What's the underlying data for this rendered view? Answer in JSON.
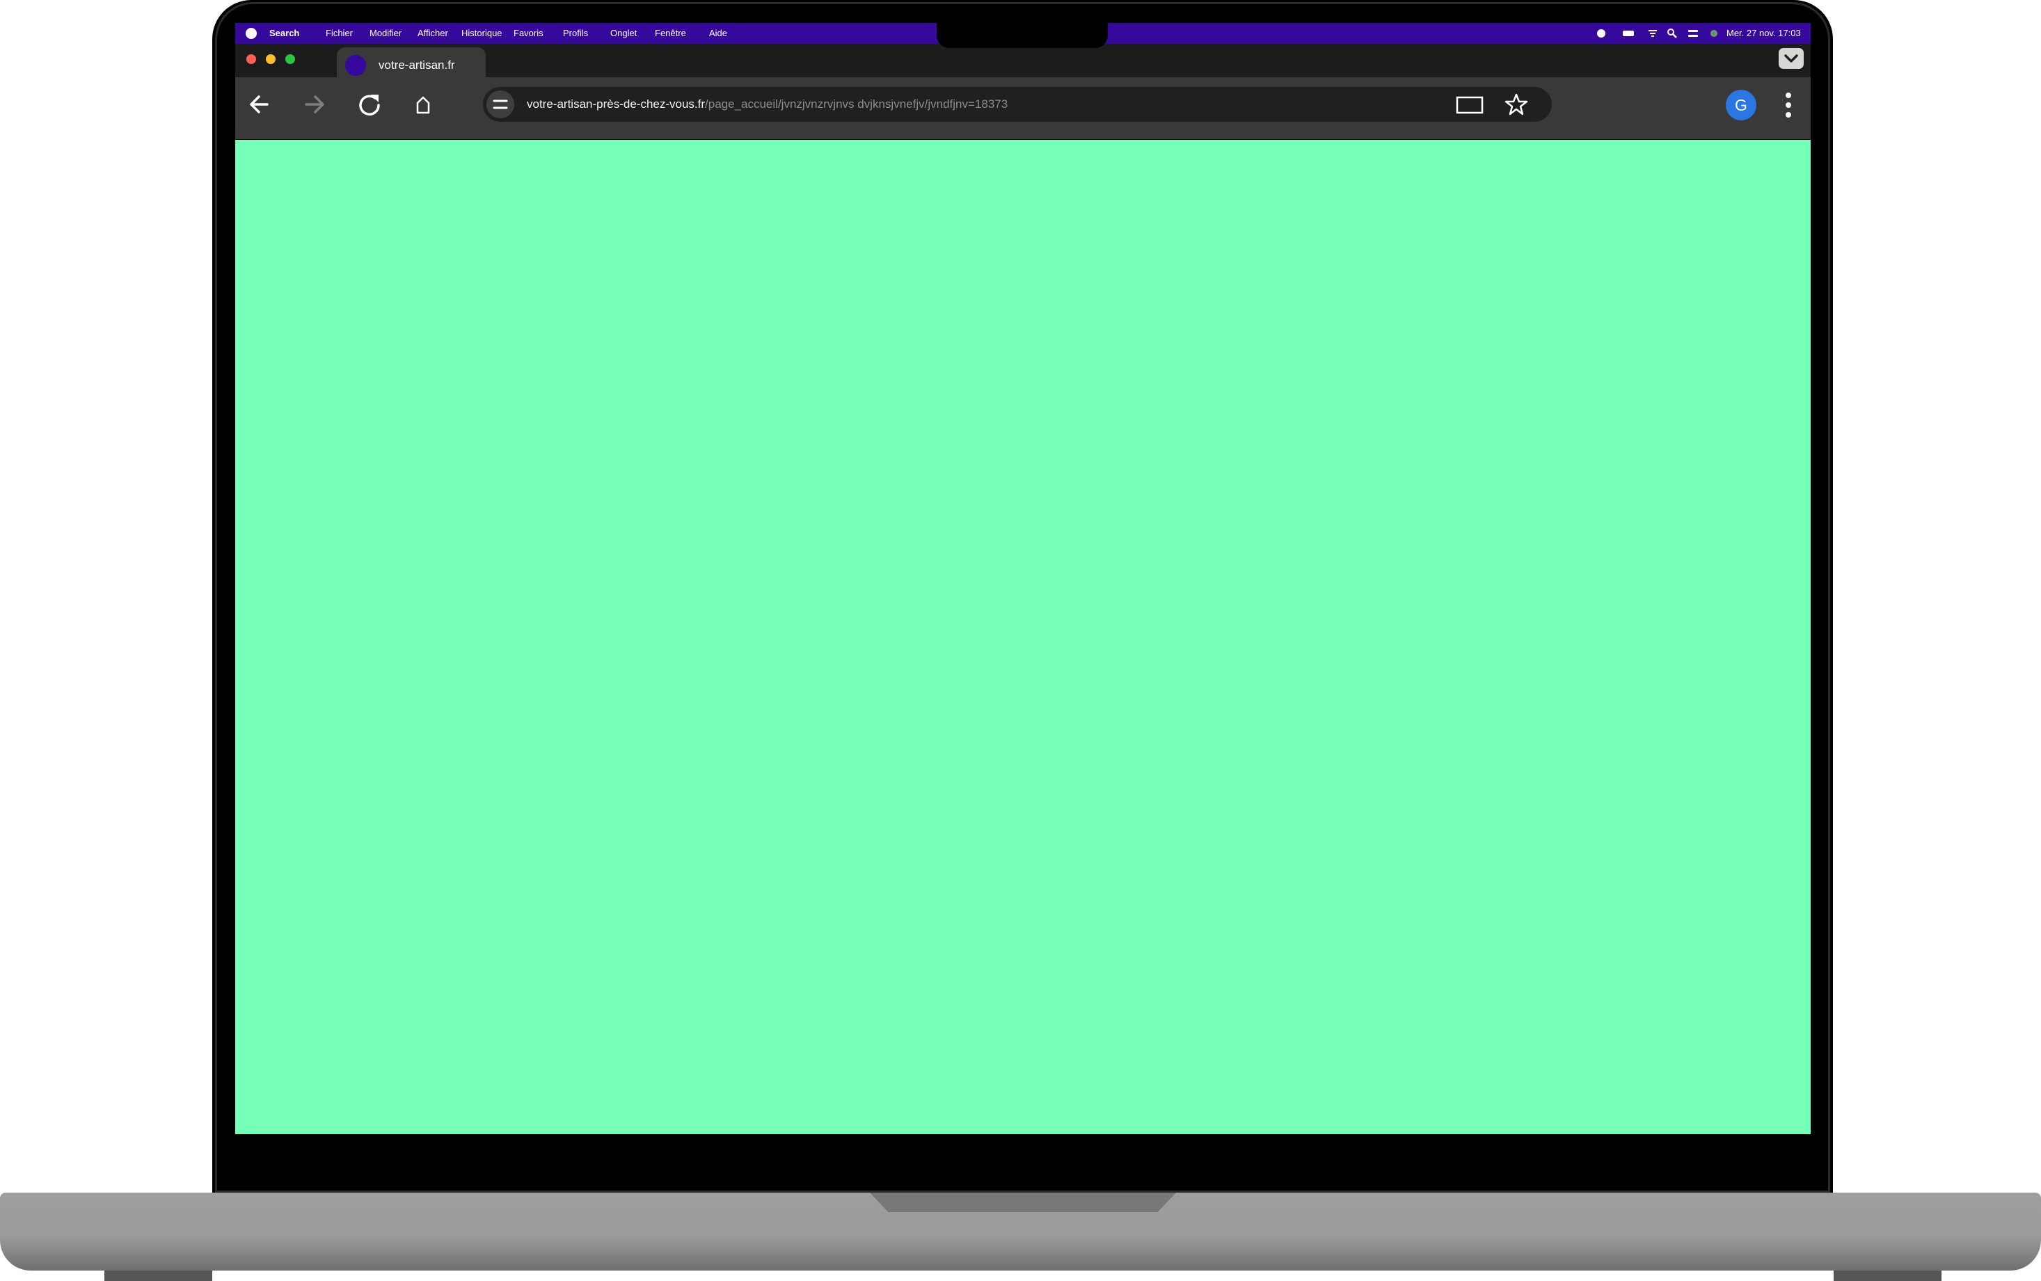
{
  "menubar": {
    "app_name": "Search",
    "items": [
      "Fichier",
      "Modifier",
      "Afficher",
      "Historique",
      "Favoris",
      "Profils",
      "Onglet",
      "Fenêtre",
      "Aide"
    ],
    "clock": "Mer. 27 nov. 17:03",
    "status_icons": [
      "record-dot-icon",
      "battery-icon",
      "wifi-icon",
      "search-icon",
      "control-center-icon",
      "siri-icon"
    ]
  },
  "tab": {
    "title": "votre-artisan.fr",
    "favicon_color": "#36089c"
  },
  "toolbar": {
    "url_domain": "votre-artisan-près-de-chez-vous.fr",
    "url_path": "/page_accueil/jvnzjvnzrvjnvs dvjknsjvnefjv/jvndfjnv=18373",
    "avatar_letter": "G"
  },
  "colors": {
    "menubar": "#36089c",
    "page_background": "#76ffb6",
    "avatar": "#2b76e0"
  }
}
